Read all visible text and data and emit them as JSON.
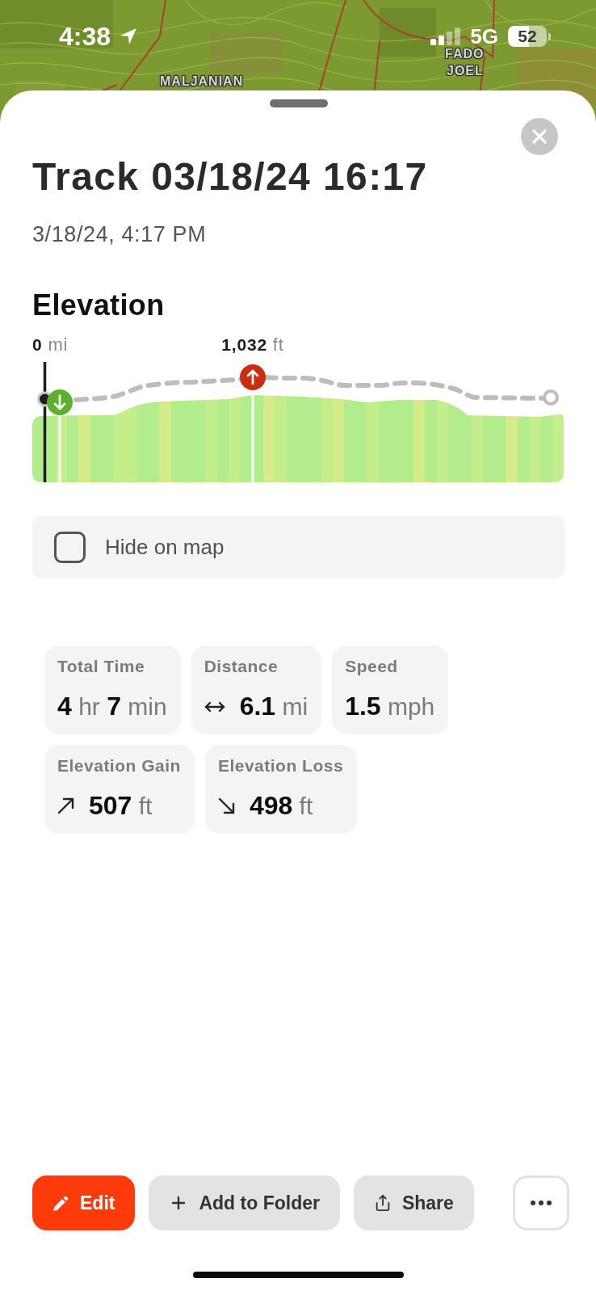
{
  "status_bar": {
    "time": "4:38",
    "network": "5G",
    "battery": "52"
  },
  "map": {
    "labels": [
      {
        "text": "MALJANIAN"
      },
      {
        "text": "FADO"
      },
      {
        "text": "JOEL"
      }
    ]
  },
  "sheet": {
    "title": "Track 03/18/24 16:17",
    "subtitle": "3/18/24, 4:17 PM"
  },
  "elevation": {
    "heading": "Elevation",
    "position_label": "**0** mi",
    "peak_label": "**1,032** ft"
  },
  "hide_on_map": {
    "label": "Hide on map",
    "checked": false
  },
  "stat_rows": [
    {
      "cards": [
        {
          "kind": "time",
          "label": "Total Time",
          "value": "**4** hr **7** min"
        },
        {
          "kind": "distance",
          "label": "Distance",
          "value": "**6.1** mi"
        },
        {
          "kind": "speed",
          "label": "Speed",
          "value": "**1.5** mph"
        }
      ]
    },
    {
      "cards": [
        {
          "kind": "gain",
          "label": "Elevation Gain",
          "value": "**507** ft"
        },
        {
          "kind": "loss",
          "label": "Elevation Loss",
          "value": "**498** ft"
        }
      ]
    }
  ],
  "actions": [
    {
      "kind": "edit",
      "label": "Edit"
    },
    {
      "kind": "add_to_folder",
      "label": "Add to Folder"
    },
    {
      "kind": "share",
      "label": "Share"
    },
    {
      "kind": "more"
    }
  ]
}
